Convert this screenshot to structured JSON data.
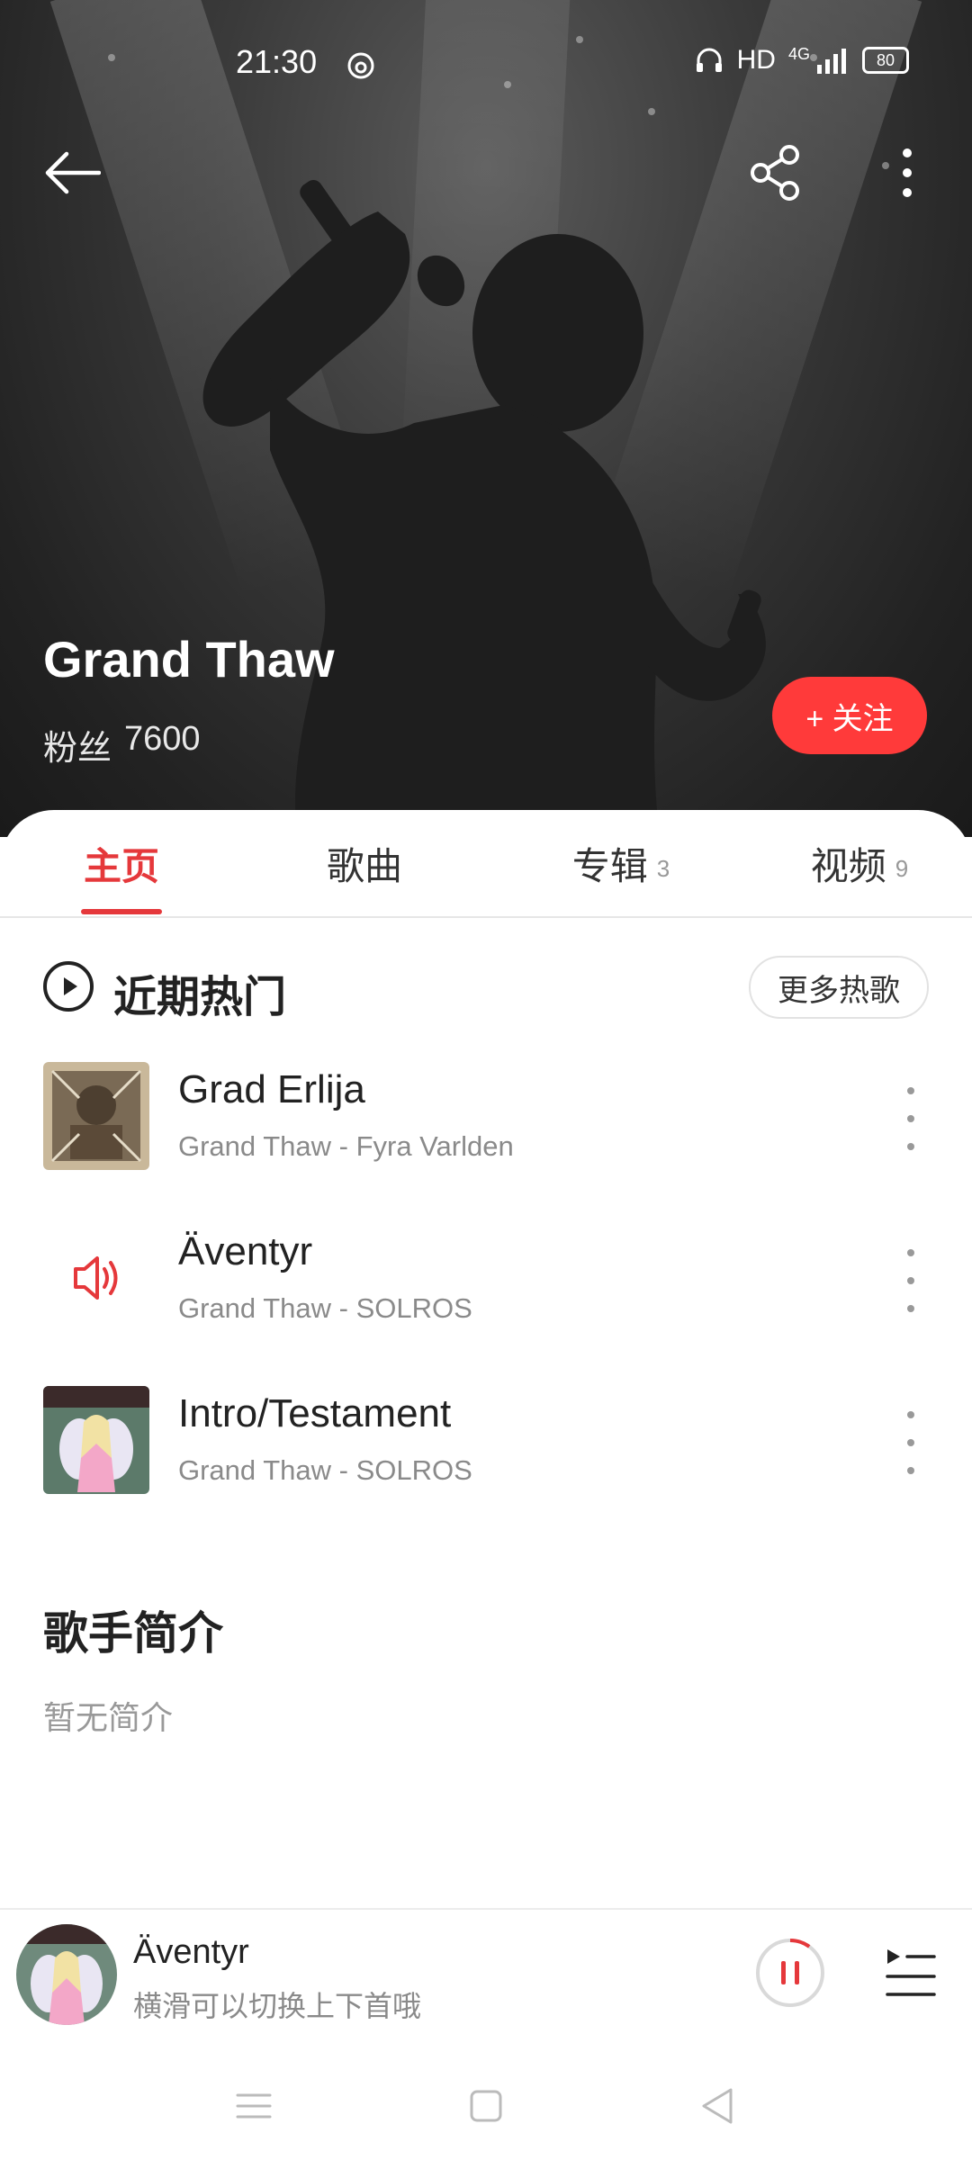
{
  "status_bar": {
    "time": "21:30",
    "network_label": "HD",
    "cellular_label": "4G",
    "battery_level": "80"
  },
  "header": {
    "artist_name": "Grand Thaw",
    "fans_label": "粉丝",
    "fans_count": "7600",
    "follow_label": "+ 关注"
  },
  "tabs": [
    {
      "label": "主页",
      "count": ""
    },
    {
      "label": "歌曲",
      "count": ""
    },
    {
      "label": "专辑",
      "count": "3"
    },
    {
      "label": "视频",
      "count": "9"
    }
  ],
  "hot_section": {
    "title": "近期热门",
    "more_label": "更多热歌"
  },
  "songs": [
    {
      "title": "Grad Erlija",
      "subtitle": "Grand Thaw - Fyra Varlden"
    },
    {
      "title": "Äventyr",
      "subtitle": "Grand Thaw - SOLROS"
    },
    {
      "title": "Intro/Testament",
      "subtitle": "Grand Thaw - SOLROS"
    }
  ],
  "bio": {
    "title": "歌手简介",
    "text": "暂无简介"
  },
  "player": {
    "title": "Äventyr",
    "hint": "横滑可以切换上下首哦",
    "playback_progress_fraction": 0.1
  },
  "colors": {
    "accent": "#e5383b",
    "follow_button": "#ff3a3a"
  },
  "icons": [
    "back-arrow-icon",
    "share-icon",
    "more-vertical-icon",
    "play-circle-icon",
    "speaker-icon",
    "pause-icon",
    "playlist-icon",
    "nav-menu-icon",
    "nav-home-icon",
    "nav-back-icon"
  ]
}
